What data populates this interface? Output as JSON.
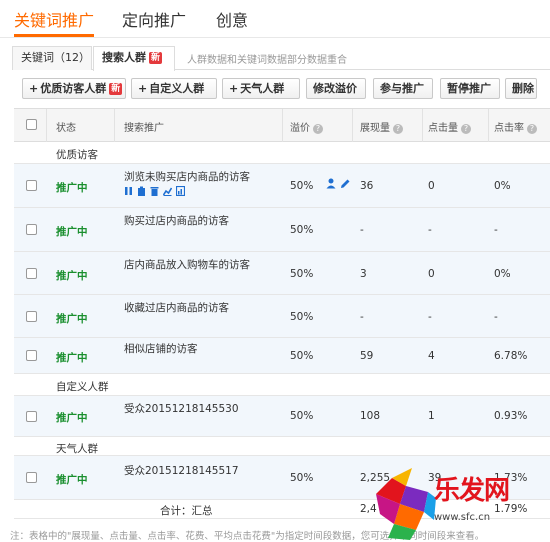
{
  "top_tabs": [
    {
      "label": "关键词推广",
      "active": true
    },
    {
      "label": "定向推广",
      "active": false
    },
    {
      "label": "创意",
      "active": false
    }
  ],
  "sub_tabs": [
    {
      "label": "关键词（12）",
      "active": false
    },
    {
      "label": "搜索人群",
      "active": true,
      "badge": "新"
    }
  ],
  "sub_note": "人群数据和关键词数据部分数据重合",
  "toolbar": {
    "premium_visitors": "优质访客人群",
    "premium_badge": "新",
    "custom_group": "自定义人群",
    "weather_group": "天气人群",
    "edit_premium": "修改溢价",
    "join_promotion": "参与推广",
    "pause_promotion": "暂停推广",
    "delete": "删除"
  },
  "columns": {
    "status": "状态",
    "search_promo": "搜索推广",
    "premium": "溢价",
    "impressions": "展现量",
    "clicks": "点击量",
    "ctr": "点击率"
  },
  "groups": {
    "premium": "优质访客",
    "custom": "自定义人群",
    "weather": "天气人群"
  },
  "rows": [
    {
      "status": "推广中",
      "name": "浏览未购买店内商品的访客",
      "premium": "50%",
      "impressions": "36",
      "clicks": "0",
      "ctr": "0%"
    },
    {
      "status": "推广中",
      "name": "购买过店内商品的访客",
      "premium": "50%",
      "impressions": "-",
      "clicks": "-",
      "ctr": "-"
    },
    {
      "status": "推广中",
      "name": "店内商品放入购物车的访客",
      "premium": "50%",
      "impressions": "3",
      "clicks": "0",
      "ctr": "0%"
    },
    {
      "status": "推广中",
      "name": "收藏过店内商品的访客",
      "premium": "50%",
      "impressions": "-",
      "clicks": "-",
      "ctr": "-"
    },
    {
      "status": "推广中",
      "name": "相似店铺的访客",
      "premium": "50%",
      "impressions": "59",
      "clicks": "4",
      "ctr": "6.78%"
    },
    {
      "status": "推广中",
      "name": "受众20151218145530",
      "premium": "50%",
      "impressions": "108",
      "clicks": "1",
      "ctr": "0.93%"
    },
    {
      "status": "推广中",
      "name": "受众20151218145517",
      "premium": "50%",
      "impressions": "2,255",
      "clicks": "39",
      "ctr": "1.73%"
    }
  ],
  "total": {
    "label": "合计：汇总",
    "impressions": "2,4",
    "clicks": "",
    "ctr": "1.79%"
  },
  "footnote": "注：表格中的\"展现量、点击量、点击率、花费、平均点击花费\"为指定时间段数据，您可选择不同时间段来查看。",
  "watermark": {
    "text": "乐发网",
    "url": "www.sfc.cn"
  },
  "colors": {
    "accent": "#ff6a00",
    "status_green": "#1a8f2e",
    "badge_red": "#e4393c",
    "icon_blue": "#1f6fd1"
  }
}
